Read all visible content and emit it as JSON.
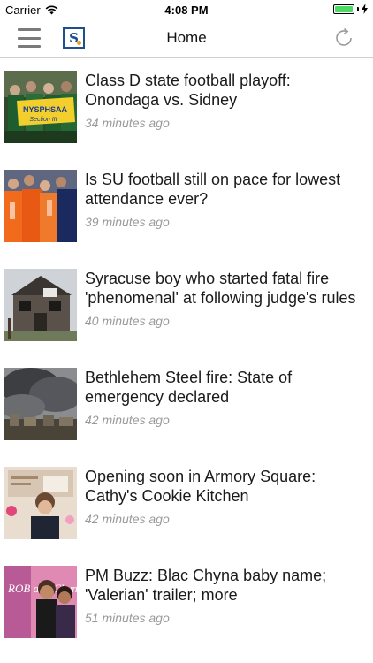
{
  "status_bar": {
    "carrier": "Carrier",
    "time": "4:08 PM",
    "battery_level": 1.0,
    "battery_color": "#4cd964"
  },
  "nav": {
    "title": "Home",
    "menu_icon": "hamburger-icon",
    "logo_icon": "syracuse-logo-icon",
    "refresh_icon": "refresh-icon"
  },
  "articles": [
    {
      "headline": "Class D state football playoff: Onondaga vs. Sidney",
      "time": "34 minutes ago",
      "logo_text": "NYSPHSAA",
      "sub_text": "Section III"
    },
    {
      "headline": "Is SU football still on pace for lowest attendance ever?",
      "time": "39 minutes ago"
    },
    {
      "headline": "Syracuse boy who started fatal fire 'phenomenal' at following judge's rules",
      "time": "40 minutes ago"
    },
    {
      "headline": "Bethlehem Steel fire: State of emergency declared",
      "time": "42 minutes ago"
    },
    {
      "headline": "Opening soon in Armory Square: Cathy's Cookie Kitchen",
      "time": "42 minutes ago"
    },
    {
      "headline": "PM Buzz: Blac Chyna baby name; 'Valerian' trailer; more",
      "time": "51 minutes ago",
      "logo_text": "ROB and Chyna"
    }
  ]
}
